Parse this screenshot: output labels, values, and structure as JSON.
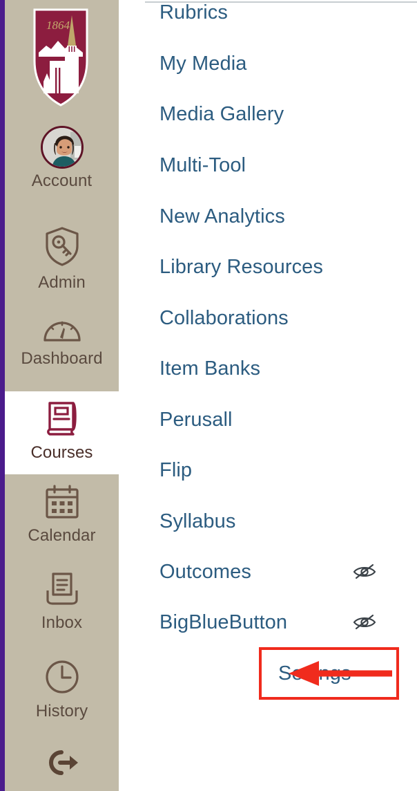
{
  "global_nav": {
    "logo": {
      "name": "university-shield-logo",
      "year_text": "1864",
      "shield_color": "#8C1D3F",
      "year_color": "#BFA76A"
    },
    "background_color": "#C2BBA8",
    "edge_accent_color": "#4B1C8C",
    "active_color": "#8C1D3F",
    "items": [
      {
        "id": "account",
        "label": "Account",
        "icon": "avatar-icon",
        "active": false
      },
      {
        "id": "admin",
        "label": "Admin",
        "icon": "shield-key-icon",
        "active": false
      },
      {
        "id": "dashboard",
        "label": "Dashboard",
        "icon": "gauge-icon",
        "active": false
      },
      {
        "id": "courses",
        "label": "Courses",
        "icon": "book-icon",
        "active": true
      },
      {
        "id": "calendar",
        "label": "Calendar",
        "icon": "calendar-icon",
        "active": false
      },
      {
        "id": "inbox",
        "label": "Inbox",
        "icon": "inbox-tray-icon",
        "active": false
      },
      {
        "id": "history",
        "label": "History",
        "icon": "clock-icon",
        "active": false
      },
      {
        "id": "logout",
        "label": "",
        "icon": "logout-arrow-icon",
        "active": false
      }
    ]
  },
  "course_nav": {
    "link_color": "#2C5C80",
    "items": [
      {
        "label": "Rubrics",
        "hidden_icon": false
      },
      {
        "label": "My Media",
        "hidden_icon": false
      },
      {
        "label": "Media Gallery",
        "hidden_icon": false
      },
      {
        "label": "Multi-Tool",
        "hidden_icon": false
      },
      {
        "label": "New Analytics",
        "hidden_icon": false
      },
      {
        "label": "Library Resources",
        "hidden_icon": false
      },
      {
        "label": "Collaborations",
        "hidden_icon": false
      },
      {
        "label": "Item Banks",
        "hidden_icon": false
      },
      {
        "label": "Perusall",
        "hidden_icon": false
      },
      {
        "label": "Flip",
        "hidden_icon": false
      },
      {
        "label": "Syllabus",
        "hidden_icon": false
      },
      {
        "label": "Outcomes",
        "hidden_icon": true
      },
      {
        "label": "BigBlueButton",
        "hidden_icon": true
      },
      {
        "label": "Settings",
        "hidden_icon": false,
        "highlighted": true
      }
    ]
  },
  "annotation": {
    "color": "#F02B1D",
    "box_target": "Settings",
    "arrow_direction": "left"
  }
}
